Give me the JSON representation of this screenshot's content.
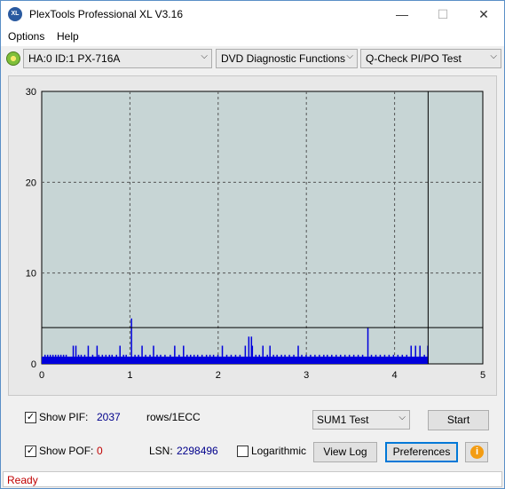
{
  "window": {
    "title": "PlexTools Professional XL V3.16",
    "app_icon_text": "XL",
    "minimize_glyph": "—",
    "maximize_glyph": "☐",
    "close_glyph": "✕"
  },
  "menu": {
    "options": "Options",
    "help": "Help"
  },
  "toolbar": {
    "drive": "HA:0 ID:1  PX-716A",
    "function": "DVD Diagnostic Functions",
    "test": "Q-Check PI/PO Test",
    "arrow": "⌵"
  },
  "chart_data": {
    "type": "bar",
    "y_ticks": [
      "30",
      "20",
      "10",
      "0"
    ],
    "x_ticks": [
      "0",
      "1",
      "2",
      "3",
      "4",
      "5"
    ],
    "xlim": [
      0,
      5
    ],
    "ylim": [
      0,
      30
    ],
    "threshold": 4,
    "end_marker_x": 4.38,
    "grid": true,
    "bar_color": "#0000dd",
    "plot_bg": "#c7d5d5",
    "bars": [
      [
        0.03,
        1
      ],
      [
        0.06,
        1
      ],
      [
        0.09,
        1
      ],
      [
        0.12,
        1
      ],
      [
        0.15,
        1
      ],
      [
        0.18,
        1
      ],
      [
        0.21,
        1
      ],
      [
        0.24,
        1
      ],
      [
        0.27,
        1
      ],
      [
        0.35,
        2
      ],
      [
        0.38,
        2
      ],
      [
        0.41,
        1
      ],
      [
        0.44,
        1
      ],
      [
        0.48,
        1
      ],
      [
        0.52,
        2
      ],
      [
        0.57,
        1
      ],
      [
        0.62,
        2
      ],
      [
        0.64,
        1
      ],
      [
        0.68,
        1
      ],
      [
        0.72,
        1
      ],
      [
        0.76,
        1
      ],
      [
        0.79,
        1
      ],
      [
        0.84,
        1
      ],
      [
        0.88,
        2
      ],
      [
        0.92,
        1
      ],
      [
        0.95,
        1
      ],
      [
        1.01,
        5
      ],
      [
        1.05,
        1
      ],
      [
        1.09,
        1
      ],
      [
        1.13,
        2
      ],
      [
        1.17,
        1
      ],
      [
        1.22,
        1
      ],
      [
        1.26,
        2
      ],
      [
        1.3,
        1
      ],
      [
        1.34,
        1
      ],
      [
        1.39,
        1
      ],
      [
        1.45,
        1
      ],
      [
        1.5,
        2
      ],
      [
        1.55,
        1
      ],
      [
        1.6,
        2
      ],
      [
        1.64,
        1
      ],
      [
        1.68,
        1
      ],
      [
        1.72,
        1
      ],
      [
        1.76,
        1
      ],
      [
        1.81,
        1
      ],
      [
        1.86,
        1
      ],
      [
        1.9,
        1
      ],
      [
        1.94,
        1
      ],
      [
        1.99,
        1
      ],
      [
        2.04,
        2
      ],
      [
        2.09,
        1
      ],
      [
        2.14,
        1
      ],
      [
        2.19,
        1
      ],
      [
        2.24,
        1
      ],
      [
        2.3,
        2
      ],
      [
        2.34,
        3
      ],
      [
        2.37,
        3
      ],
      [
        2.38,
        2
      ],
      [
        2.42,
        1
      ],
      [
        2.46,
        1
      ],
      [
        2.5,
        2
      ],
      [
        2.55,
        1
      ],
      [
        2.58,
        2
      ],
      [
        2.62,
        1
      ],
      [
        2.66,
        1
      ],
      [
        2.71,
        1
      ],
      [
        2.75,
        1
      ],
      [
        2.8,
        1
      ],
      [
        2.85,
        1
      ],
      [
        2.9,
        2
      ],
      [
        2.94,
        1
      ],
      [
        2.99,
        1
      ],
      [
        3.04,
        1
      ],
      [
        3.09,
        1
      ],
      [
        3.14,
        1
      ],
      [
        3.19,
        1
      ],
      [
        3.23,
        1
      ],
      [
        3.28,
        1
      ],
      [
        3.33,
        1
      ],
      [
        3.38,
        1
      ],
      [
        3.43,
        1
      ],
      [
        3.48,
        1
      ],
      [
        3.53,
        1
      ],
      [
        3.58,
        1
      ],
      [
        3.63,
        1
      ],
      [
        3.69,
        4
      ],
      [
        3.73,
        1
      ],
      [
        3.78,
        1
      ],
      [
        3.83,
        1
      ],
      [
        3.88,
        1
      ],
      [
        3.93,
        1
      ],
      [
        3.98,
        1
      ],
      [
        4.03,
        1
      ],
      [
        4.08,
        1
      ],
      [
        4.13,
        1
      ],
      [
        4.18,
        2
      ],
      [
        4.23,
        2
      ],
      [
        4.28,
        2
      ],
      [
        4.33,
        1
      ],
      [
        4.37,
        2
      ]
    ]
  },
  "controls": {
    "show_pif_label": "Show PIF:",
    "pif_value": "2037",
    "rows_label": "rows/1ECC",
    "show_pof_label": "Show POF:",
    "pof_value": "0",
    "lsn_label": "LSN:",
    "lsn_value": "2298496",
    "logarithmic_label": "Logarithmic",
    "sum_select": "SUM1 Test",
    "start_button": "Start",
    "view_log_button": "View Log",
    "preferences_button": "Preferences",
    "info_glyph": "i",
    "check_glyph": "✓"
  },
  "status": {
    "text": "Ready"
  }
}
